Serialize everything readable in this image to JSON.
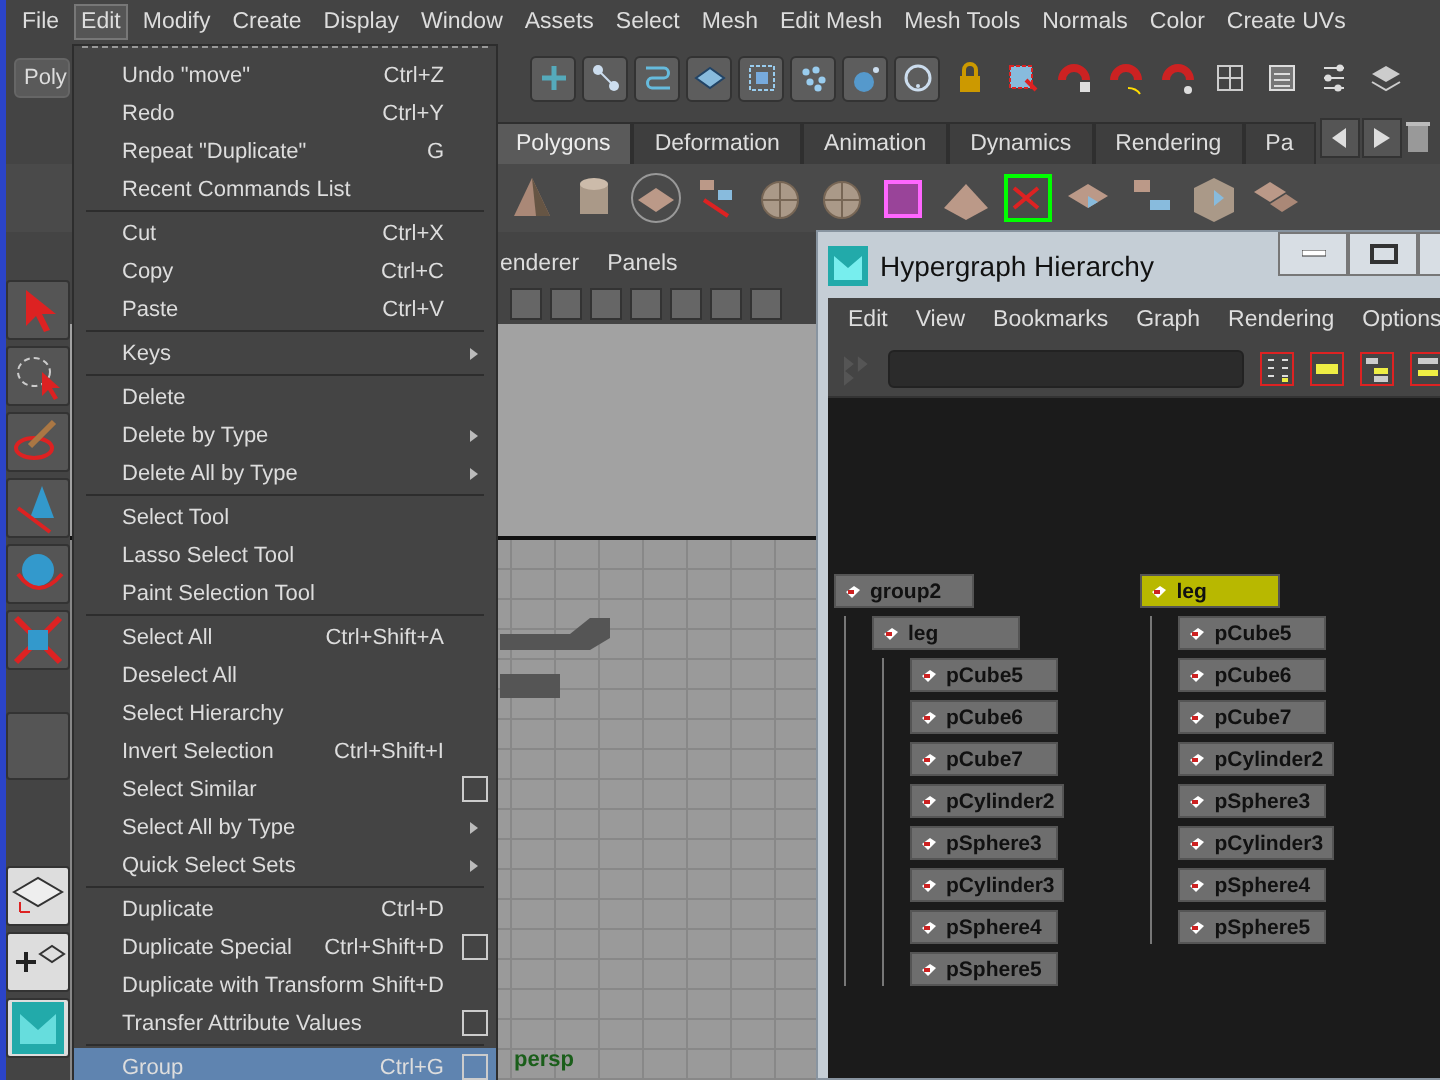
{
  "menubar": [
    {
      "label": "File",
      "selected": false
    },
    {
      "label": "Edit",
      "selected": true
    },
    {
      "label": "Modify",
      "selected": false
    },
    {
      "label": "Create",
      "selected": false
    },
    {
      "label": "Display",
      "selected": false
    },
    {
      "label": "Window",
      "selected": false
    },
    {
      "label": "Assets",
      "selected": false
    },
    {
      "label": "Select",
      "selected": false
    },
    {
      "label": "Mesh",
      "selected": false
    },
    {
      "label": "Edit Mesh",
      "selected": false
    },
    {
      "label": "Mesh Tools",
      "selected": false
    },
    {
      "label": "Normals",
      "selected": false
    },
    {
      "label": "Color",
      "selected": false
    },
    {
      "label": "Create UVs",
      "selected": false
    }
  ],
  "status_line": {
    "mode_menu": "Poly"
  },
  "shelf": {
    "tabs": [
      {
        "label": "Polygons",
        "selected": true
      },
      {
        "label": "Deformation",
        "selected": false
      },
      {
        "label": "Animation",
        "selected": false
      },
      {
        "label": "Dynamics",
        "selected": false
      },
      {
        "label": "Rendering",
        "selected": false
      },
      {
        "label": "Pa",
        "selected": false
      }
    ]
  },
  "viewport": {
    "panel_menu": [
      "enderer",
      "Panels"
    ],
    "camera": "persp"
  },
  "edit_menu": {
    "sections": [
      [
        {
          "label": "Undo \"move\"",
          "shortcut": "Ctrl+Z",
          "submenu": false,
          "option_box": false,
          "selected": false
        },
        {
          "label": "Redo",
          "shortcut": "Ctrl+Y",
          "submenu": false,
          "option_box": false,
          "selected": false
        },
        {
          "label": "Repeat \"Duplicate\"",
          "shortcut": "G",
          "submenu": false,
          "option_box": false,
          "selected": false
        },
        {
          "label": "Recent Commands List",
          "submenu": false,
          "option_box": false,
          "selected": false
        }
      ],
      [
        {
          "label": "Cut",
          "shortcut": "Ctrl+X",
          "submenu": false,
          "option_box": false,
          "selected": false
        },
        {
          "label": "Copy",
          "shortcut": "Ctrl+C",
          "submenu": false,
          "option_box": false,
          "selected": false
        },
        {
          "label": "Paste",
          "shortcut": "Ctrl+V",
          "submenu": false,
          "option_box": false,
          "selected": false
        }
      ],
      [
        {
          "label": "Keys",
          "submenu": true,
          "option_box": false,
          "selected": false
        }
      ],
      [
        {
          "label": "Delete",
          "submenu": false,
          "option_box": false,
          "selected": false
        },
        {
          "label": "Delete by Type",
          "submenu": true,
          "option_box": false,
          "selected": false
        },
        {
          "label": "Delete All by Type",
          "submenu": true,
          "option_box": false,
          "selected": false
        }
      ],
      [
        {
          "label": "Select Tool",
          "submenu": false,
          "option_box": false,
          "selected": false
        },
        {
          "label": "Lasso Select Tool",
          "submenu": false,
          "option_box": false,
          "selected": false
        },
        {
          "label": "Paint Selection Tool",
          "submenu": false,
          "option_box": false,
          "selected": false
        }
      ],
      [
        {
          "label": "Select All",
          "shortcut": "Ctrl+Shift+A",
          "submenu": false,
          "option_box": false,
          "selected": false
        },
        {
          "label": "Deselect All",
          "submenu": false,
          "option_box": false,
          "selected": false
        },
        {
          "label": "Select Hierarchy",
          "submenu": false,
          "option_box": false,
          "selected": false
        },
        {
          "label": "Invert Selection",
          "shortcut": "Ctrl+Shift+I",
          "submenu": false,
          "option_box": false,
          "selected": false
        },
        {
          "label": "Select Similar",
          "submenu": false,
          "option_box": true,
          "selected": false
        },
        {
          "label": "Select All by Type",
          "submenu": true,
          "option_box": false,
          "selected": false
        },
        {
          "label": "Quick Select Sets",
          "submenu": true,
          "option_box": false,
          "selected": false
        }
      ],
      [
        {
          "label": "Duplicate",
          "shortcut": "Ctrl+D",
          "submenu": false,
          "option_box": false,
          "selected": false
        },
        {
          "label": "Duplicate Special",
          "shortcut": "Ctrl+Shift+D",
          "submenu": false,
          "option_box": true,
          "selected": false
        },
        {
          "label": "Duplicate with Transform",
          "shortcut": "Shift+D",
          "submenu": false,
          "option_box": false,
          "selected": false
        },
        {
          "label": "Transfer Attribute Values",
          "submenu": false,
          "option_box": true,
          "selected": false
        }
      ],
      [
        {
          "label": "Group",
          "shortcut": "Ctrl+G",
          "submenu": false,
          "option_box": true,
          "selected": true
        }
      ]
    ]
  },
  "hypergraph": {
    "title": "Hypergraph Hierarchy",
    "menu": [
      "Edit",
      "View",
      "Bookmarks",
      "Graph",
      "Rendering",
      "Options"
    ],
    "nodes": [
      {
        "label": "group2",
        "selected": false,
        "children": [
          {
            "label": "leg",
            "selected": false,
            "children": [
              {
                "label": "pCube5",
                "selected": false
              },
              {
                "label": "pCube6",
                "selected": false
              },
              {
                "label": "pCube7",
                "selected": false
              },
              {
                "label": "pCylinder2",
                "selected": false
              },
              {
                "label": "pSphere3",
                "selected": false
              },
              {
                "label": "pCylinder3",
                "selected": false
              },
              {
                "label": "pSphere4",
                "selected": false
              },
              {
                "label": "pSphere5",
                "selected": false
              }
            ]
          }
        ]
      },
      {
        "label": "leg",
        "selected": true,
        "children": [
          {
            "label": "pCube5",
            "selected": false
          },
          {
            "label": "pCube6",
            "selected": false
          },
          {
            "label": "pCube7",
            "selected": false
          },
          {
            "label": "pCylinder2",
            "selected": false
          },
          {
            "label": "pSphere3",
            "selected": false
          },
          {
            "label": "pCylinder3",
            "selected": false
          },
          {
            "label": "pSphere4",
            "selected": false
          },
          {
            "label": "pSphere5",
            "selected": false
          }
        ]
      }
    ]
  }
}
